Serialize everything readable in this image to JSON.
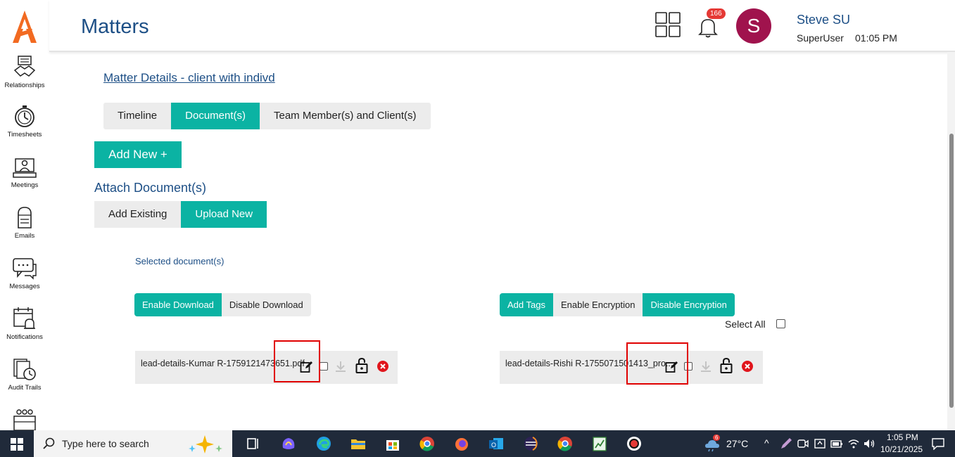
{
  "header": {
    "title": "Matters",
    "notification_count": "166",
    "avatar_initial": "S",
    "user_name": "Steve SU",
    "user_role": "SuperUser",
    "time": "01:05 PM"
  },
  "sidebar": {
    "items": [
      {
        "label": "Relationships",
        "icon": "handshake-icon"
      },
      {
        "label": "Timesheets",
        "icon": "stopwatch-icon"
      },
      {
        "label": "Meetings",
        "icon": "meeting-icon"
      },
      {
        "label": "Emails",
        "icon": "mailbox-icon"
      },
      {
        "label": "Messages",
        "icon": "chat-icon"
      },
      {
        "label": "Notifications",
        "icon": "calendar-bell-icon"
      },
      {
        "label": "Audit Trails",
        "icon": "audit-clock-icon"
      }
    ]
  },
  "main": {
    "breadcrumb": "Matter Details - client with indivd",
    "tabs": [
      "Timeline",
      "Document(s)",
      "Team Member(s) and Client(s)"
    ],
    "add_new": "Add New +",
    "attach_title": "Attach Document(s)",
    "attach_options": [
      "Add Existing",
      "Upload New"
    ],
    "selected_label": "Selected document(s)",
    "download_options": [
      "Enable Download",
      "Disable Download"
    ],
    "tag_options": [
      "Add Tags",
      "Enable Encryption",
      "Disable Encryption"
    ],
    "select_all": "Select All",
    "documents": [
      {
        "name": "lead-details-Kumar R-1759121473651.pdf"
      },
      {
        "name": "lead-details-Rishi R-1755071501413_pro..."
      }
    ]
  },
  "taskbar": {
    "search_placeholder": "Type here to search",
    "weather_count": "6",
    "temperature": "27°C",
    "time": "1:05 PM",
    "date": "10/21/2025"
  },
  "colors": {
    "accent": "#0bb3a3",
    "title_blue": "#1d4f86",
    "avatar": "#a0134d",
    "highlight": "#e00000"
  }
}
